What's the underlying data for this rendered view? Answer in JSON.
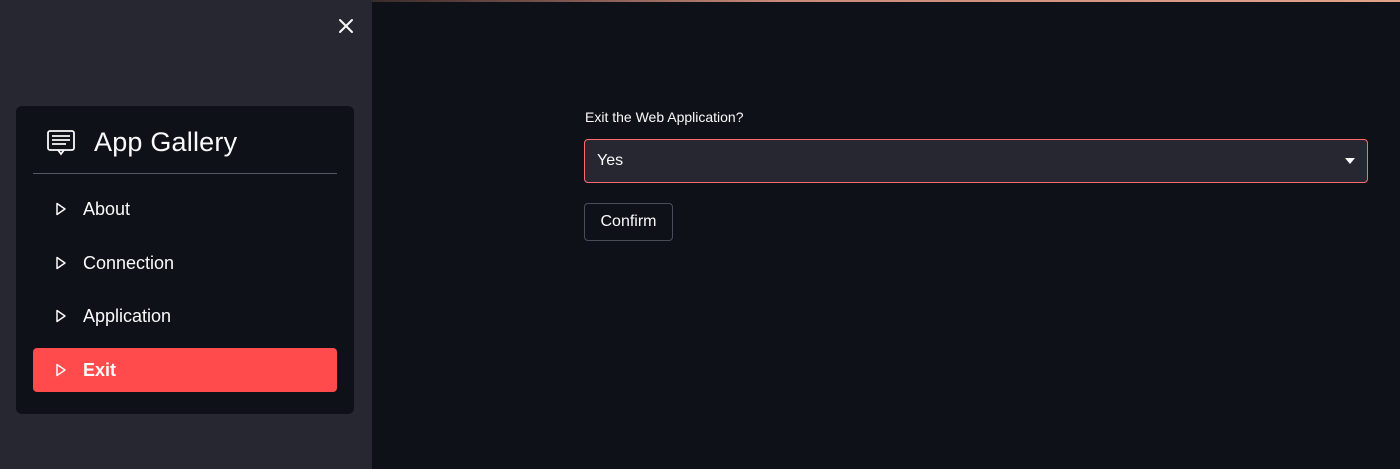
{
  "sidebar": {
    "close_icon": "close-icon",
    "menu": {
      "title": "App Gallery",
      "title_icon": "document-list-icon",
      "items": [
        {
          "label": "About",
          "icon": "triangle-right-outline-icon",
          "active": false
        },
        {
          "label": "Connection",
          "icon": "triangle-right-outline-icon",
          "active": false
        },
        {
          "label": "Application",
          "icon": "triangle-right-outline-icon",
          "active": false
        },
        {
          "label": "Exit",
          "icon": "triangle-right-outline-icon",
          "active": true
        }
      ]
    }
  },
  "main": {
    "select_label": "Exit the Web Application?",
    "select_value": "Yes",
    "confirm_label": "Confirm"
  },
  "colors": {
    "sidebar_bg": "#262730",
    "main_bg": "#0e1117",
    "accent": "#ff4b4b"
  }
}
